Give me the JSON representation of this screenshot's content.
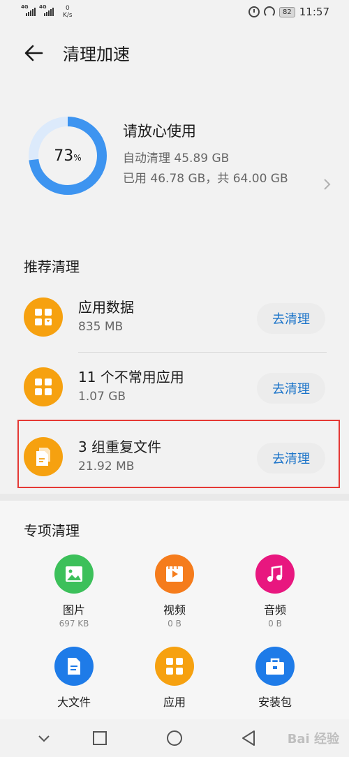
{
  "status_bar": {
    "net1": "4G",
    "net2": "4G",
    "speed_value": "0",
    "speed_unit": "K/s",
    "battery": "82",
    "time": "11:57",
    "icons": [
      "alarm-icon",
      "gauge-icon"
    ]
  },
  "header": {
    "title": "清理加速",
    "back_icon": "arrow-left-icon"
  },
  "storage": {
    "percent": "73",
    "percent_sign": "%",
    "usage_fraction": 0.73,
    "status": "请放心使用",
    "auto_clean": "自动清理 45.89 GB",
    "used": "已用 46.78 GB，共 64.00 GB",
    "ring_color": "#3d94f0",
    "ring_track_color": "#dceafb"
  },
  "recommended": {
    "title": "推荐清理",
    "button_label": "去清理",
    "items": [
      {
        "name": "应用数据",
        "size": "835 MB",
        "icon": "app-data-icon"
      },
      {
        "name": "11 个不常用应用",
        "size": "1.07 GB",
        "icon": "apps-grid-icon"
      },
      {
        "name": "3 组重复文件",
        "size": "21.92 MB",
        "icon": "duplicate-files-icon"
      }
    ],
    "icon_color": "#f6a110",
    "highlight_color": "#e53935"
  },
  "special": {
    "title": "专项清理",
    "items": [
      {
        "name": "图片",
        "size": "697 KB",
        "icon": "image-icon",
        "color": "#3cc05a"
      },
      {
        "name": "视频",
        "size": "0 B",
        "icon": "video-icon",
        "color": "#f57c1c"
      },
      {
        "name": "音频",
        "size": "0 B",
        "icon": "music-icon",
        "color": "#e8177f"
      },
      {
        "name": "大文件",
        "size": "",
        "icon": "document-icon",
        "color": "#1e7be8"
      },
      {
        "name": "应用",
        "size": "",
        "icon": "apps-grid-icon",
        "color": "#f6a110"
      },
      {
        "name": "安装包",
        "size": "",
        "icon": "package-icon",
        "color": "#1e7be8"
      }
    ]
  },
  "nav": {
    "icons": [
      "nav-down-icon",
      "nav-recent-icon",
      "nav-home-icon",
      "nav-back-icon"
    ]
  },
  "watermark": "Bai 经验",
  "accent_color": "#1a73c9"
}
